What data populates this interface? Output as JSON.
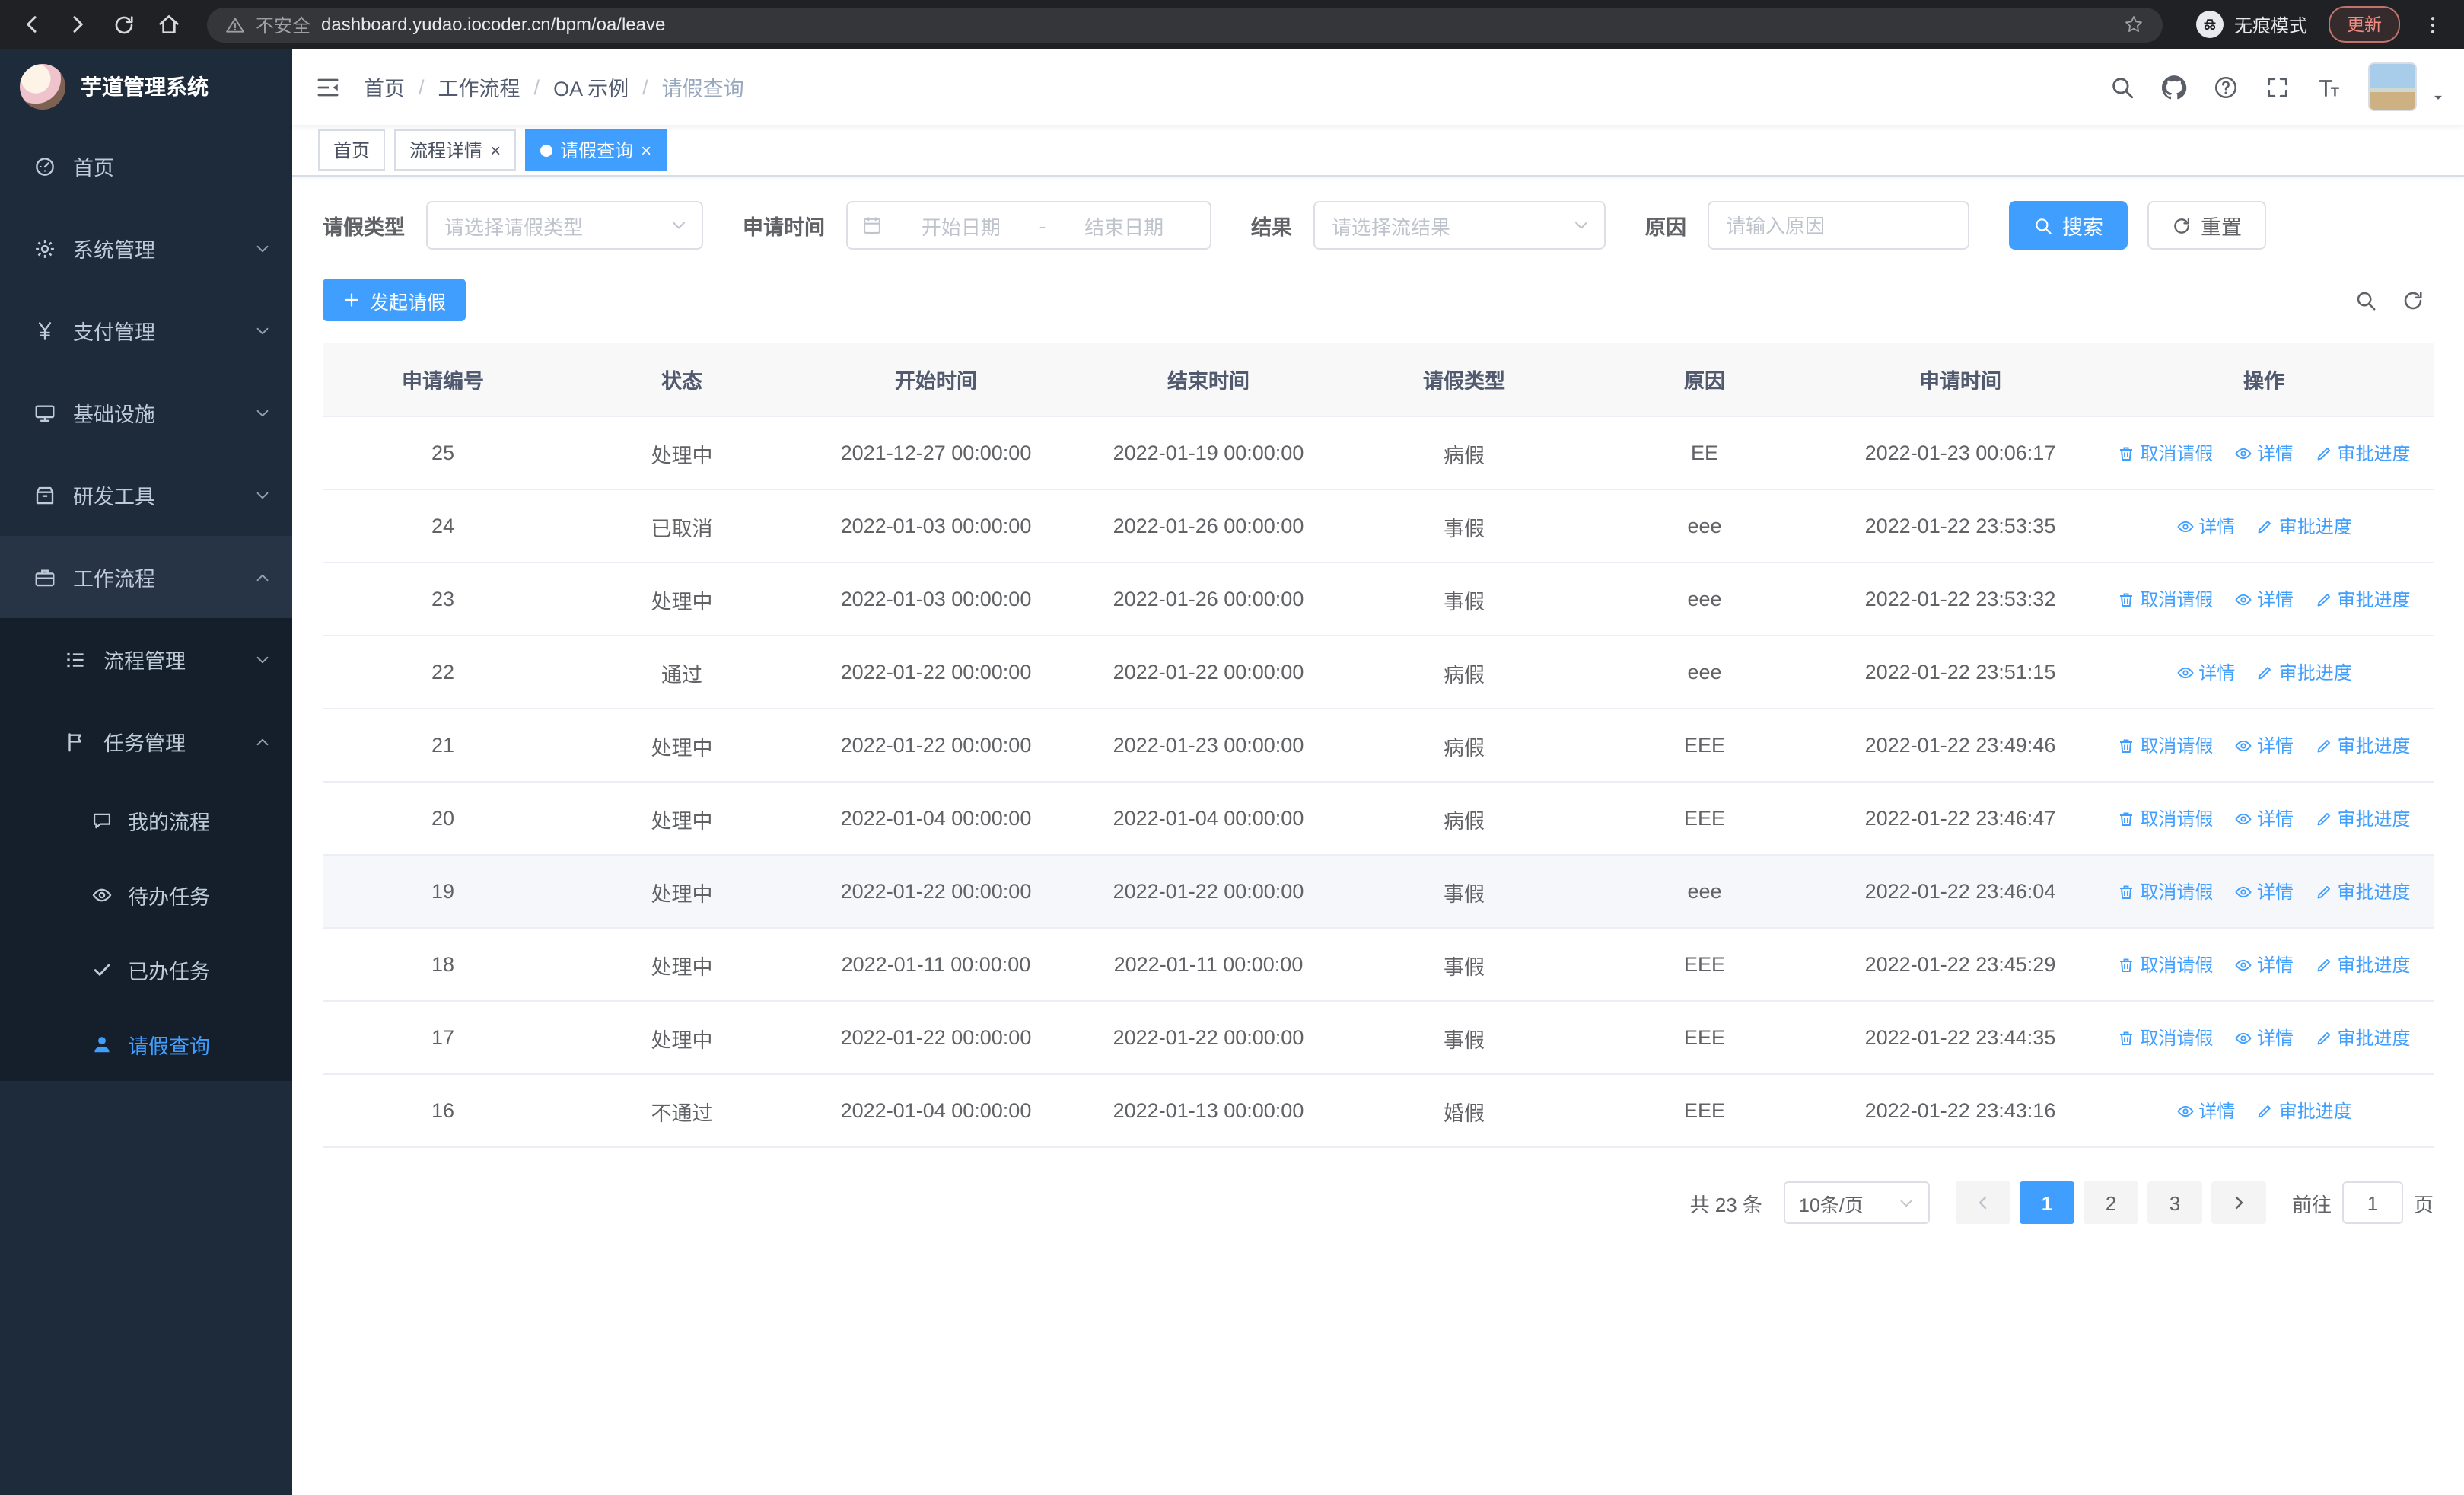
{
  "browser": {
    "security_text": "不安全",
    "url": "dashboard.yudao.iocoder.cn/bpm/oa/leave",
    "incognito_label": "无痕模式",
    "update_label": "更新"
  },
  "ui": {
    "breadcrumb_separator": "/",
    "tab_close_glyph": "×"
  },
  "sidebar": {
    "app_title": "芋道管理系统",
    "top_items": [
      {
        "label": "首页"
      },
      {
        "label": "系统管理"
      },
      {
        "label": "支付管理"
      },
      {
        "label": "基础设施"
      },
      {
        "label": "研发工具"
      },
      {
        "label": "工作流程"
      }
    ],
    "sub_items": [
      {
        "label": "流程管理"
      },
      {
        "label": "任务管理"
      }
    ],
    "leaf_items": [
      {
        "label": "我的流程"
      },
      {
        "label": "待办任务"
      },
      {
        "label": "已办任务"
      },
      {
        "label": "请假查询"
      }
    ]
  },
  "header": {
    "breadcrumbs": [
      "首页",
      "工作流程",
      "OA 示例",
      "请假查询"
    ]
  },
  "tabs": [
    {
      "label": "首页"
    },
    {
      "label": "流程详情"
    },
    {
      "label": "请假查询"
    }
  ],
  "filters": {
    "leave_type_label": "请假类型",
    "leave_type_placeholder": "请选择请假类型",
    "apply_time_label": "申请时间",
    "date_start_placeholder": "开始日期",
    "date_separator": "-",
    "date_end_placeholder": "结束日期",
    "result_label": "结果",
    "result_placeholder": "请选择流结果",
    "reason_label": "原因",
    "reason_placeholder": "请输入原因",
    "search_button": "搜索",
    "reset_button": "重置"
  },
  "toolbar": {
    "create_button": "发起请假"
  },
  "table": {
    "headers": [
      "申请编号",
      "状态",
      "开始时间",
      "结束时间",
      "请假类型",
      "原因",
      "申请时间",
      "操作"
    ],
    "action_labels": {
      "cancel": "取消请假",
      "detail": "详情",
      "progress": "审批进度"
    },
    "rows": [
      {
        "id": "25",
        "status": "处理中",
        "start": "2021-12-27 00:00:00",
        "end": "2022-01-19 00:00:00",
        "type": "病假",
        "reason": "EE",
        "apply_time": "2022-01-23 00:06:17",
        "can_cancel": true
      },
      {
        "id": "24",
        "status": "已取消",
        "start": "2022-01-03 00:00:00",
        "end": "2022-01-26 00:00:00",
        "type": "事假",
        "reason": "eee",
        "apply_time": "2022-01-22 23:53:35",
        "can_cancel": false
      },
      {
        "id": "23",
        "status": "处理中",
        "start": "2022-01-03 00:00:00",
        "end": "2022-01-26 00:00:00",
        "type": "事假",
        "reason": "eee",
        "apply_time": "2022-01-22 23:53:32",
        "can_cancel": true
      },
      {
        "id": "22",
        "status": "通过",
        "start": "2022-01-22 00:00:00",
        "end": "2022-01-22 00:00:00",
        "type": "病假",
        "reason": "eee",
        "apply_time": "2022-01-22 23:51:15",
        "can_cancel": false
      },
      {
        "id": "21",
        "status": "处理中",
        "start": "2022-01-22 00:00:00",
        "end": "2022-01-23 00:00:00",
        "type": "病假",
        "reason": "EEE",
        "apply_time": "2022-01-22 23:49:46",
        "can_cancel": true
      },
      {
        "id": "20",
        "status": "处理中",
        "start": "2022-01-04 00:00:00",
        "end": "2022-01-04 00:00:00",
        "type": "病假",
        "reason": "EEE",
        "apply_time": "2022-01-22 23:46:47",
        "can_cancel": true
      },
      {
        "id": "19",
        "status": "处理中",
        "start": "2022-01-22 00:00:00",
        "end": "2022-01-22 00:00:00",
        "type": "事假",
        "reason": "eee",
        "apply_time": "2022-01-22 23:46:04",
        "can_cancel": true,
        "hovered": true
      },
      {
        "id": "18",
        "status": "处理中",
        "start": "2022-01-11 00:00:00",
        "end": "2022-01-11 00:00:00",
        "type": "事假",
        "reason": "EEE",
        "apply_time": "2022-01-22 23:45:29",
        "can_cancel": true
      },
      {
        "id": "17",
        "status": "处理中",
        "start": "2022-01-22 00:00:00",
        "end": "2022-01-22 00:00:00",
        "type": "事假",
        "reason": "EEE",
        "apply_time": "2022-01-22 23:44:35",
        "can_cancel": true
      },
      {
        "id": "16",
        "status": "不通过",
        "start": "2022-01-04 00:00:00",
        "end": "2022-01-13 00:00:00",
        "type": "婚假",
        "reason": "EEE",
        "apply_time": "2022-01-22 23:43:16",
        "can_cancel": false
      }
    ]
  },
  "pagination": {
    "total_text": "共 23 条",
    "page_size_text": "10条/页",
    "pages": [
      "1",
      "2",
      "3"
    ],
    "goto_label": "前往",
    "goto_value": "1",
    "goto_suffix": "页"
  },
  "colors": {
    "primary": "#409eff",
    "sidebar_bg": "#1d2b3a",
    "table_header_bg": "#f8f8f9"
  }
}
